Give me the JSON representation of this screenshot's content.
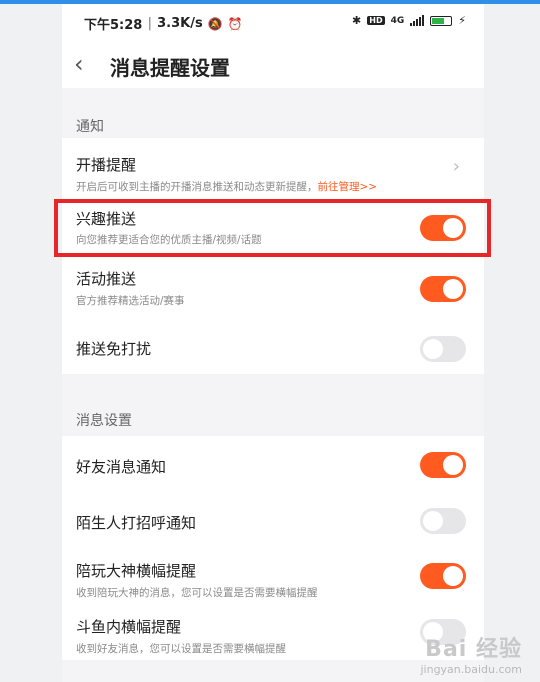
{
  "status": {
    "time": "下午5:28",
    "speed": "3.3K/s",
    "network": "4G",
    "hd": "HD",
    "battery_level": 0.7
  },
  "header": {
    "title": "消息提醒设置"
  },
  "sections": {
    "notify": {
      "label": "通知",
      "items": [
        {
          "title": "开播提醒",
          "sub": "开启后可收到主播的开播消息推送和动态更新提醒，",
          "link": "前往管理>>"
        },
        {
          "title": "兴趣推送",
          "sub": "向您推荐更适合您的优质主播/视频/话题",
          "toggle": true
        },
        {
          "title": "活动推送",
          "sub": "官方推荐精选活动/赛事",
          "toggle": true
        },
        {
          "title": "推送免打扰",
          "toggle": false
        }
      ]
    },
    "message": {
      "label": "消息设置",
      "items": [
        {
          "title": "好友消息通知",
          "toggle": true
        },
        {
          "title": "陌生人打招呼通知",
          "toggle": false
        },
        {
          "title": "陪玩大神横幅提醒",
          "sub": "收到陪玩大神的消息，您可以设置是否需要横幅提醒",
          "toggle": true
        },
        {
          "title": "斗鱼内横幅提醒",
          "sub": "收到好友消息，您可以设置是否需要横幅提醒",
          "toggle": false
        }
      ]
    }
  },
  "watermark": {
    "brand": "Bai 经验",
    "url": "jingyan.baidu.com"
  },
  "colors": {
    "accent": "#ff5a1f",
    "highlight": "#e8262a",
    "toggle_off": "#e6e6e8"
  }
}
